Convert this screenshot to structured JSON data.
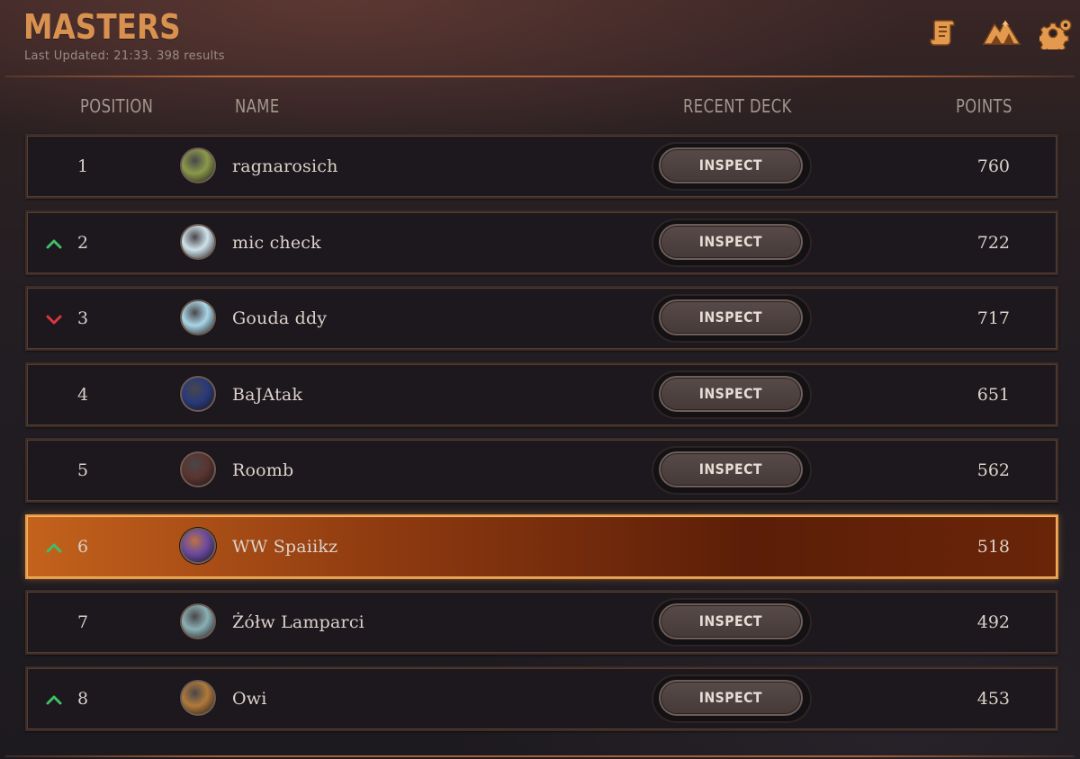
{
  "header": {
    "title": "MASTERS",
    "subtitle": "Last Updated: 21:33. 398 results",
    "icons": [
      "scroll-icon",
      "mountain-icon",
      "gear-icon"
    ]
  },
  "columns": {
    "position": "POSITION",
    "name": "NAME",
    "recent_deck": "RECENT DECK",
    "points": "POINTS"
  },
  "rows": [
    {
      "position": "1",
      "name": "ragnarosich",
      "points": "760",
      "trend": "none",
      "inspect": "INSPECT",
      "highlight": false,
      "avatar_color": "#8a9a4a"
    },
    {
      "position": "2",
      "name": "mic check",
      "points": "722",
      "trend": "up",
      "inspect": "INSPECT",
      "highlight": false,
      "avatar_color": "#cfe3ea"
    },
    {
      "position": "3",
      "name": "Gouda ddy",
      "points": "717",
      "trend": "down",
      "inspect": "INSPECT",
      "highlight": false,
      "avatar_color": "#a9d6e6"
    },
    {
      "position": "4",
      "name": "BaJAtak",
      "points": "651",
      "trend": "none",
      "inspect": "INSPECT",
      "highlight": false,
      "avatar_color": "#2a3a7a"
    },
    {
      "position": "5",
      "name": "Roomb",
      "points": "562",
      "trend": "none",
      "inspect": "INSPECT",
      "highlight": false,
      "avatar_color": "#5a3530"
    },
    {
      "position": "6",
      "name": "WW Spaiikz",
      "points": "518",
      "trend": "up",
      "inspect": "",
      "highlight": true,
      "avatar_color": "#6a4aa0"
    },
    {
      "position": "7",
      "name": "Żółw Lamparci",
      "points": "492",
      "trend": "none",
      "inspect": "INSPECT",
      "highlight": false,
      "avatar_color": "#8ab0b4"
    },
    {
      "position": "8",
      "name": "Owi",
      "points": "453",
      "trend": "up",
      "inspect": "INSPECT",
      "highlight": false,
      "avatar_color": "#b07a3a"
    }
  ],
  "colors": {
    "title": "#d9914f",
    "trend_up": "#3fbf6a",
    "trend_down": "#d8383f",
    "highlight_row": "#c4621c"
  }
}
